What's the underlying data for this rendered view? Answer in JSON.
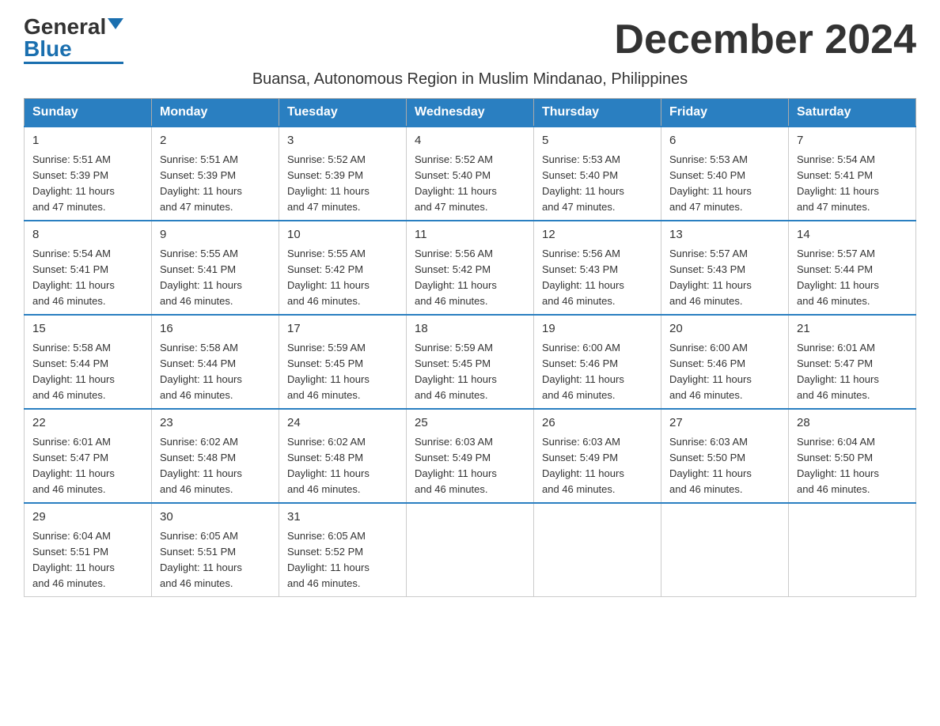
{
  "header": {
    "logo_general": "General",
    "logo_blue": "Blue",
    "month_title": "December 2024",
    "subtitle": "Buansa, Autonomous Region in Muslim Mindanao, Philippines"
  },
  "weekdays": [
    "Sunday",
    "Monday",
    "Tuesday",
    "Wednesday",
    "Thursday",
    "Friday",
    "Saturday"
  ],
  "weeks": [
    [
      {
        "day": "1",
        "sunrise": "5:51 AM",
        "sunset": "5:39 PM",
        "daylight": "11 hours and 47 minutes."
      },
      {
        "day": "2",
        "sunrise": "5:51 AM",
        "sunset": "5:39 PM",
        "daylight": "11 hours and 47 minutes."
      },
      {
        "day": "3",
        "sunrise": "5:52 AM",
        "sunset": "5:39 PM",
        "daylight": "11 hours and 47 minutes."
      },
      {
        "day": "4",
        "sunrise": "5:52 AM",
        "sunset": "5:40 PM",
        "daylight": "11 hours and 47 minutes."
      },
      {
        "day": "5",
        "sunrise": "5:53 AM",
        "sunset": "5:40 PM",
        "daylight": "11 hours and 47 minutes."
      },
      {
        "day": "6",
        "sunrise": "5:53 AM",
        "sunset": "5:40 PM",
        "daylight": "11 hours and 47 minutes."
      },
      {
        "day": "7",
        "sunrise": "5:54 AM",
        "sunset": "5:41 PM",
        "daylight": "11 hours and 47 minutes."
      }
    ],
    [
      {
        "day": "8",
        "sunrise": "5:54 AM",
        "sunset": "5:41 PM",
        "daylight": "11 hours and 46 minutes."
      },
      {
        "day": "9",
        "sunrise": "5:55 AM",
        "sunset": "5:41 PM",
        "daylight": "11 hours and 46 minutes."
      },
      {
        "day": "10",
        "sunrise": "5:55 AM",
        "sunset": "5:42 PM",
        "daylight": "11 hours and 46 minutes."
      },
      {
        "day": "11",
        "sunrise": "5:56 AM",
        "sunset": "5:42 PM",
        "daylight": "11 hours and 46 minutes."
      },
      {
        "day": "12",
        "sunrise": "5:56 AM",
        "sunset": "5:43 PM",
        "daylight": "11 hours and 46 minutes."
      },
      {
        "day": "13",
        "sunrise": "5:57 AM",
        "sunset": "5:43 PM",
        "daylight": "11 hours and 46 minutes."
      },
      {
        "day": "14",
        "sunrise": "5:57 AM",
        "sunset": "5:44 PM",
        "daylight": "11 hours and 46 minutes."
      }
    ],
    [
      {
        "day": "15",
        "sunrise": "5:58 AM",
        "sunset": "5:44 PM",
        "daylight": "11 hours and 46 minutes."
      },
      {
        "day": "16",
        "sunrise": "5:58 AM",
        "sunset": "5:44 PM",
        "daylight": "11 hours and 46 minutes."
      },
      {
        "day": "17",
        "sunrise": "5:59 AM",
        "sunset": "5:45 PM",
        "daylight": "11 hours and 46 minutes."
      },
      {
        "day": "18",
        "sunrise": "5:59 AM",
        "sunset": "5:45 PM",
        "daylight": "11 hours and 46 minutes."
      },
      {
        "day": "19",
        "sunrise": "6:00 AM",
        "sunset": "5:46 PM",
        "daylight": "11 hours and 46 minutes."
      },
      {
        "day": "20",
        "sunrise": "6:00 AM",
        "sunset": "5:46 PM",
        "daylight": "11 hours and 46 minutes."
      },
      {
        "day": "21",
        "sunrise": "6:01 AM",
        "sunset": "5:47 PM",
        "daylight": "11 hours and 46 minutes."
      }
    ],
    [
      {
        "day": "22",
        "sunrise": "6:01 AM",
        "sunset": "5:47 PM",
        "daylight": "11 hours and 46 minutes."
      },
      {
        "day": "23",
        "sunrise": "6:02 AM",
        "sunset": "5:48 PM",
        "daylight": "11 hours and 46 minutes."
      },
      {
        "day": "24",
        "sunrise": "6:02 AM",
        "sunset": "5:48 PM",
        "daylight": "11 hours and 46 minutes."
      },
      {
        "day": "25",
        "sunrise": "6:03 AM",
        "sunset": "5:49 PM",
        "daylight": "11 hours and 46 minutes."
      },
      {
        "day": "26",
        "sunrise": "6:03 AM",
        "sunset": "5:49 PM",
        "daylight": "11 hours and 46 minutes."
      },
      {
        "day": "27",
        "sunrise": "6:03 AM",
        "sunset": "5:50 PM",
        "daylight": "11 hours and 46 minutes."
      },
      {
        "day": "28",
        "sunrise": "6:04 AM",
        "sunset": "5:50 PM",
        "daylight": "11 hours and 46 minutes."
      }
    ],
    [
      {
        "day": "29",
        "sunrise": "6:04 AM",
        "sunset": "5:51 PM",
        "daylight": "11 hours and 46 minutes."
      },
      {
        "day": "30",
        "sunrise": "6:05 AM",
        "sunset": "5:51 PM",
        "daylight": "11 hours and 46 minutes."
      },
      {
        "day": "31",
        "sunrise": "6:05 AM",
        "sunset": "5:52 PM",
        "daylight": "11 hours and 46 minutes."
      },
      null,
      null,
      null,
      null
    ]
  ],
  "labels": {
    "sunrise": "Sunrise:",
    "sunset": "Sunset:",
    "daylight": "Daylight:"
  }
}
